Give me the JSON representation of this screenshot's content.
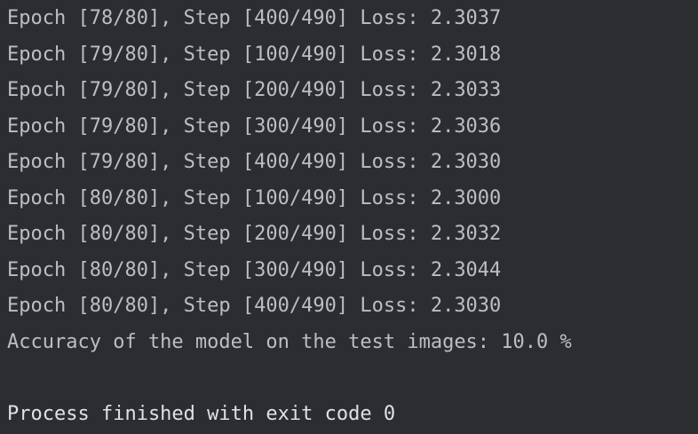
{
  "console": {
    "lines": [
      "Epoch [78/80], Step [400/490] Loss: 2.3037",
      "Epoch [79/80], Step [100/490] Loss: 2.3018",
      "Epoch [79/80], Step [200/490] Loss: 2.3033",
      "Epoch [79/80], Step [300/490] Loss: 2.3036",
      "Epoch [79/80], Step [400/490] Loss: 2.3030",
      "Epoch [80/80], Step [100/490] Loss: 2.3000",
      "Epoch [80/80], Step [200/490] Loss: 2.3032",
      "Epoch [80/80], Step [300/490] Loss: 2.3044",
      "Epoch [80/80], Step [400/490] Loss: 2.3030",
      "Accuracy of the model on the test images: 10.0 %"
    ],
    "exit_message": "Process finished with exit code 0"
  },
  "colors": {
    "background": "#2b2d30",
    "output_text": "#bcbec4",
    "exit_text": "#dfe1e5"
  }
}
